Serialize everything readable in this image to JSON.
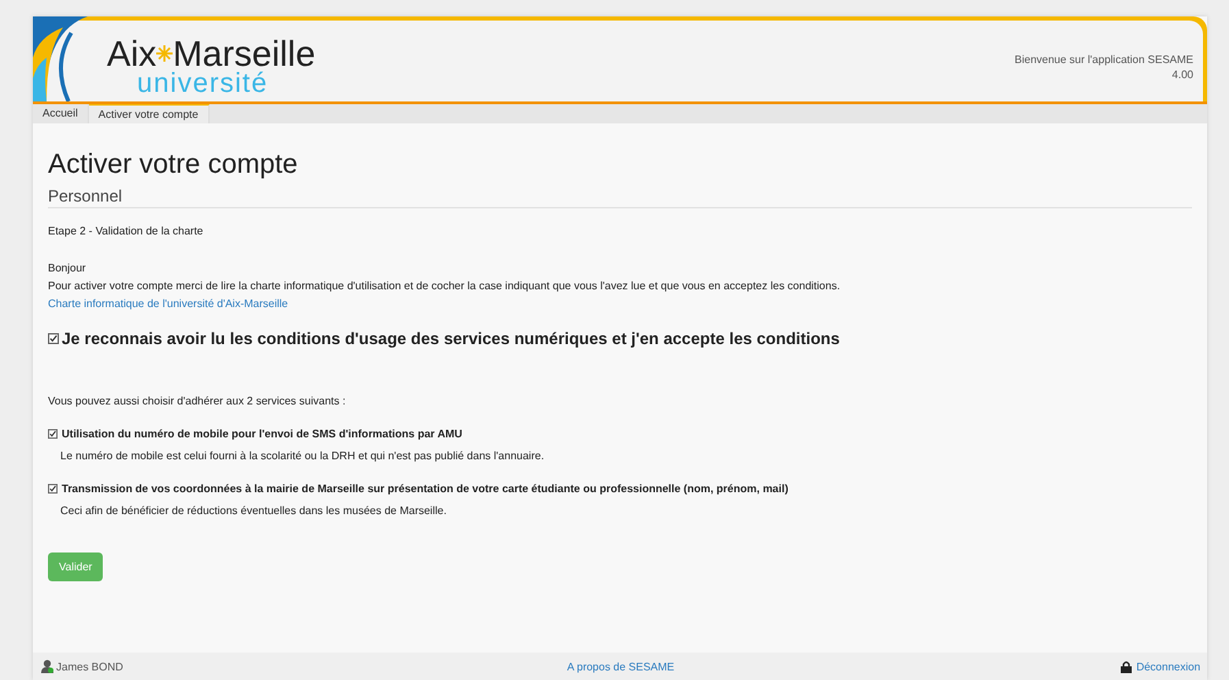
{
  "header": {
    "logo": {
      "word_1": "Aix",
      "word_2": "Marseille",
      "word_3": "université"
    },
    "welcome": "Bienvenue sur l'application SESAME",
    "version": "4.00"
  },
  "tabs": [
    {
      "label": "Accueil",
      "selected": false
    },
    {
      "label": "Activer votre compte",
      "selected": true
    }
  ],
  "title": "Activer votre compte",
  "subtitle": "Personnel",
  "step": "Etape 2 - Validation de la charte",
  "greeting": "Bonjour",
  "intro": "Pour activer votre compte merci de lire la charte informatique d'utilisation et de cocher la case indiquant que vous l'avez lue et que vous en acceptez les conditions.",
  "charter_link": "Charte informatique de l'université d'Aix-Marseille",
  "main_checkbox": {
    "checked": true,
    "label": "Je reconnais avoir lu les conditions d'usage des services numériques et j'en accepte les conditions"
  },
  "services_intro": "Vous pouvez aussi choisir d'adhérer aux 2 services suivants :",
  "services": [
    {
      "checked": true,
      "label": "Utilisation du numéro de mobile pour l'envoi de SMS d'informations par AMU",
      "note": "Le numéro de mobile est celui fourni à la scolarité ou la DRH et qui n'est pas publié dans l'annuaire."
    },
    {
      "checked": true,
      "label": "Transmission de vos coordonnées à la mairie de Marseille sur présentation de votre carte étudiante ou professionnelle (nom, prénom, mail)",
      "note": "Ceci afin de bénéficier de réductions éventuelles dans les musées de Marseille."
    }
  ],
  "submit": "Valider",
  "footer": {
    "user": "James BOND",
    "about": "A propos de SESAME",
    "logout": "Déconnexion"
  }
}
